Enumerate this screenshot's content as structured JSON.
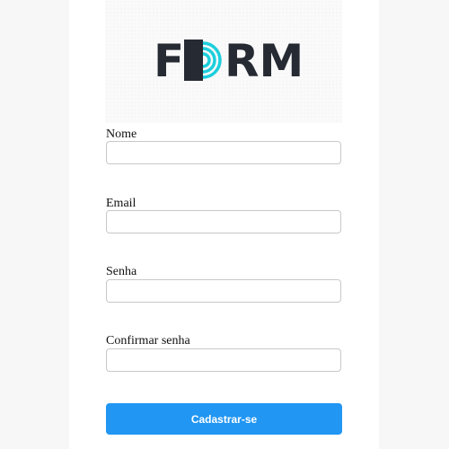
{
  "logo": {
    "letters_before": "F",
    "letters_after": "RM",
    "accent_color": "#1ccfdc",
    "text_color": "#262a33"
  },
  "form": {
    "fields": [
      {
        "label": "Nome",
        "value": "",
        "placeholder": "",
        "type": "text"
      },
      {
        "label": "Email",
        "value": "",
        "placeholder": "",
        "type": "email"
      },
      {
        "label": "Senha",
        "value": "",
        "placeholder": "",
        "type": "password"
      },
      {
        "label": "Confirmar senha",
        "value": "",
        "placeholder": "",
        "type": "password"
      }
    ],
    "submit_label": "Cadastrar-se"
  },
  "colors": {
    "button_bg": "#2196f3",
    "button_text": "#ffffff",
    "page_bg": "#f7f7f7",
    "panel_bg": "#ffffff"
  }
}
